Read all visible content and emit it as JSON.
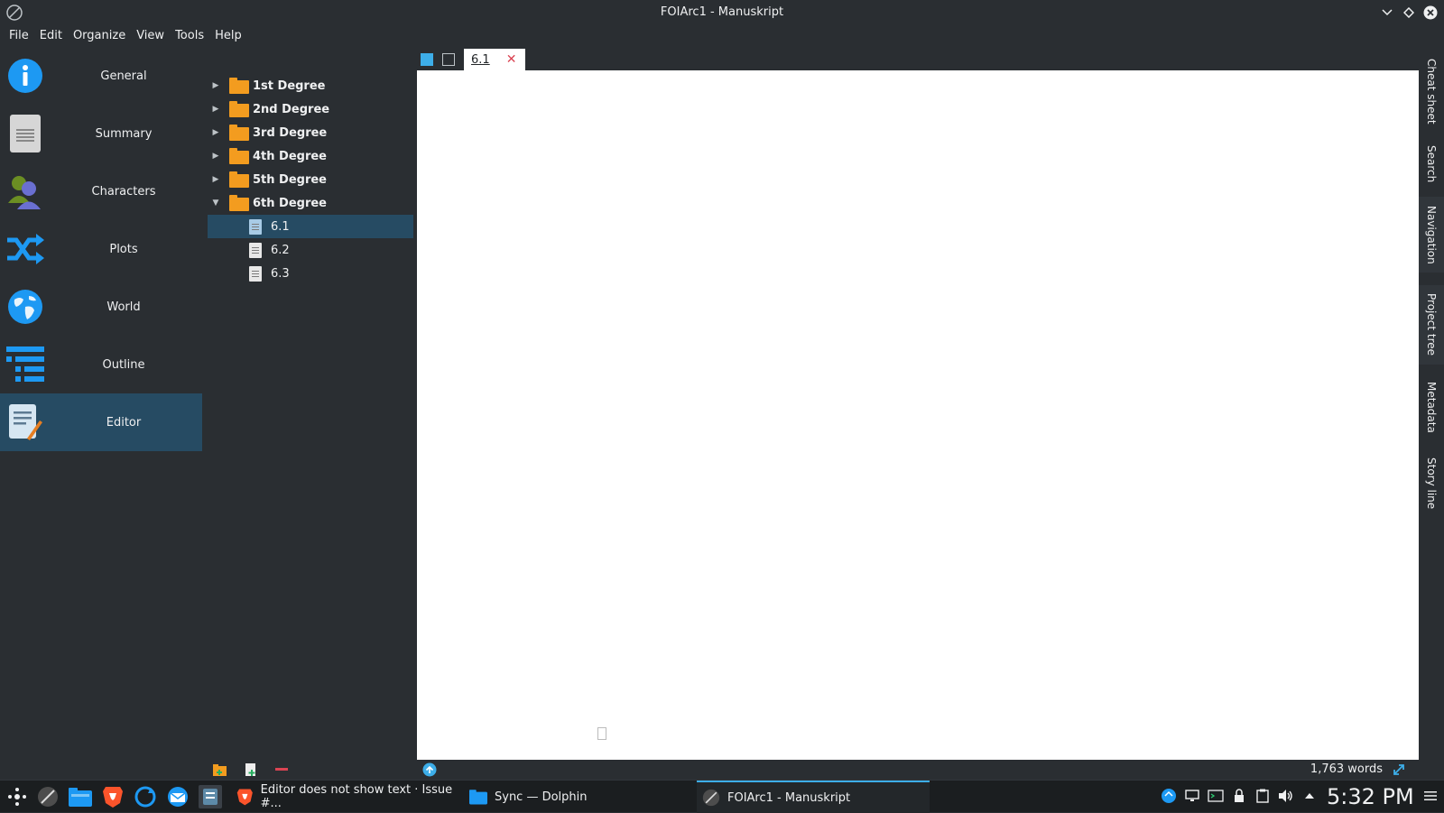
{
  "window": {
    "title": "FOIArc1 - Manuskript"
  },
  "menu": [
    {
      "label": "File"
    },
    {
      "label": "Edit"
    },
    {
      "label": "Organize"
    },
    {
      "label": "View"
    },
    {
      "label": "Tools"
    },
    {
      "label": "Help"
    }
  ],
  "sidebar": {
    "items": [
      {
        "label": "General",
        "icon": "info-icon"
      },
      {
        "label": "Summary",
        "icon": "summary-icon"
      },
      {
        "label": "Characters",
        "icon": "characters-icon"
      },
      {
        "label": "Plots",
        "icon": "shuffle-icon"
      },
      {
        "label": "World",
        "icon": "globe-icon"
      },
      {
        "label": "Outline",
        "icon": "outline-icon"
      },
      {
        "label": "Editor",
        "icon": "editor-icon",
        "active": true
      }
    ]
  },
  "tree": {
    "folders": [
      {
        "label": "1st Degree"
      },
      {
        "label": "2nd Degree"
      },
      {
        "label": "3rd Degree"
      },
      {
        "label": "4th Degree"
      },
      {
        "label": "5th Degree"
      },
      {
        "label": "6th Degree",
        "expanded": true
      }
    ],
    "docs": [
      {
        "label": "6.1",
        "selected": true
      },
      {
        "label": "6.2"
      },
      {
        "label": "6.3"
      }
    ]
  },
  "editor": {
    "tab_label": "6.1",
    "word_count": "1,763 words"
  },
  "right_tabs": [
    {
      "label": "Cheat sheet"
    },
    {
      "label": "Search"
    },
    {
      "label": "Navigation"
    },
    {
      "label": "Project tree"
    },
    {
      "label": "Metadata"
    },
    {
      "label": "Story line"
    }
  ],
  "taskbar": {
    "tasks": [
      {
        "label": "Editor does not show text · Issue #..."
      },
      {
        "label": "Sync — Dolphin"
      },
      {
        "label": "FOIArc1 - Manuskript",
        "active": true
      }
    ],
    "clock": "5:32 PM"
  },
  "colors": {
    "accent": "#3daee9",
    "selection": "#264b63",
    "folder": "#f39c1f",
    "background": "#2a2e32"
  }
}
